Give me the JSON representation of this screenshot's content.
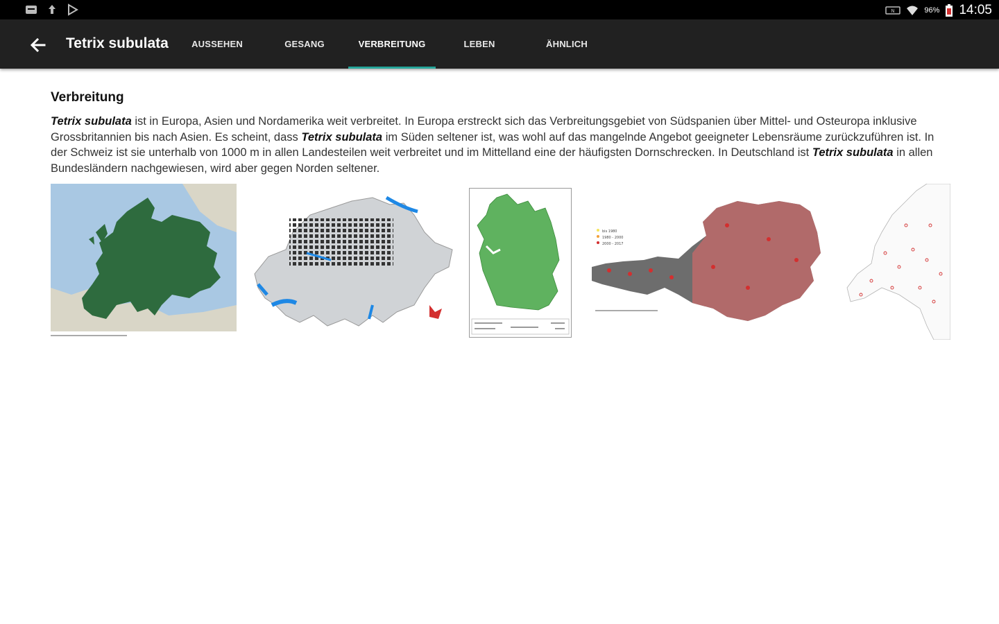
{
  "status_bar": {
    "left_icons": [
      "cast-icon",
      "upload-icon",
      "play-store-icon"
    ],
    "right_icons": [
      "nfc-icon",
      "wifi-icon",
      "battery-icon"
    ],
    "battery": "96%",
    "time": "14:05"
  },
  "app_bar": {
    "title": "Tetrix subulata",
    "tabs": [
      {
        "label": "AUSSEHEN",
        "active": false
      },
      {
        "label": "GESANG",
        "active": false
      },
      {
        "label": "VERBREITUNG",
        "active": true
      },
      {
        "label": "LEBEN",
        "active": false
      },
      {
        "label": "ÄHNLICH",
        "active": false
      }
    ],
    "accent_color": "#26a69a"
  },
  "section": {
    "title": "Verbreitung",
    "species": "Tetrix subulata",
    "text_1": " ist in Europa, Asien und Nordamerika weit verbreitet. In Europa erstreckt sich das Verbreitungsgebiet von Südspanien über Mittel- und Osteuropa inklusive Grossbritannien bis nach Asien. Es scheint, dass ",
    "text_2": " im Süden seltener ist, was wohl auf das mangelnde Angebot geeigneter Lebensräume zurückzuführen ist. In der Schweiz ist sie unterhalb von 1000 m in allen Landesteilen weit verbreitet und im Mittelland eine der häufigsten Dornschrecken. In Deutschland ist ",
    "text_3": " in allen Bundesländern nachgewiesen, wird aber gegen Norden seltener."
  },
  "maps": {
    "items": [
      "europe-map",
      "switzerland-map",
      "germany-map",
      "austria-map",
      "netherlands-map"
    ],
    "europe_color": "#2e6b3e",
    "germany_color": "#5fb25f",
    "austria_legend": [
      "bis 1980",
      "1980 - 2000",
      "2000 - 2017"
    ]
  }
}
